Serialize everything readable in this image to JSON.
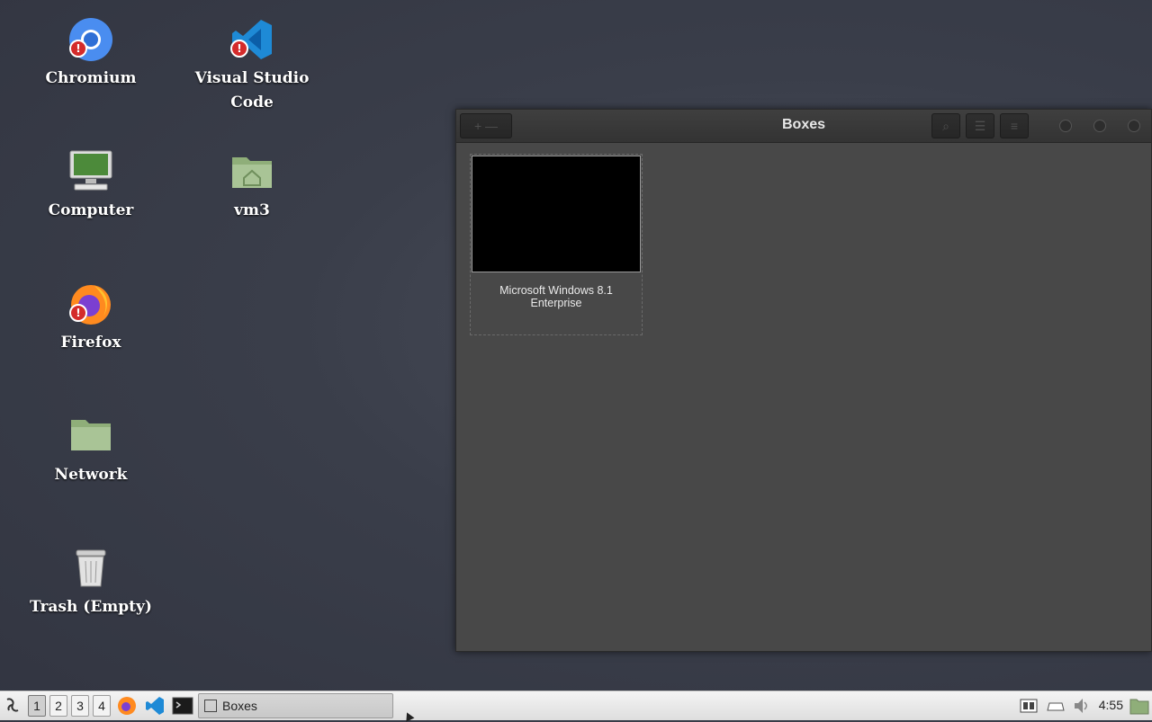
{
  "desktop": {
    "icons": [
      {
        "label": "Chromium",
        "icon": "chromium-icon"
      },
      {
        "label": "Visual Studio Code",
        "icon": "vscode-icon"
      },
      {
        "label": "Computer",
        "icon": "computer-icon"
      },
      {
        "label": "vm3",
        "icon": "home-folder-icon"
      },
      {
        "label": "Firefox",
        "icon": "firefox-icon"
      },
      {
        "label": "Network",
        "icon": "network-folder-icon"
      },
      {
        "label": "Trash (Empty)",
        "icon": "trash-icon"
      }
    ]
  },
  "window": {
    "title": "Boxes",
    "new_label": "+",
    "vms": [
      {
        "name": "Microsoft Windows 8.1 Enterprise"
      }
    ]
  },
  "taskbar": {
    "workspaces": [
      "1",
      "2",
      "3",
      "4"
    ],
    "active_workspace": "1",
    "task_label": "Boxes",
    "clock": "4:55"
  },
  "colors": {
    "desktop_bg": "#3a3e4a",
    "window_bg": "#484848",
    "taskbar_bg": "#e8e8e8"
  }
}
